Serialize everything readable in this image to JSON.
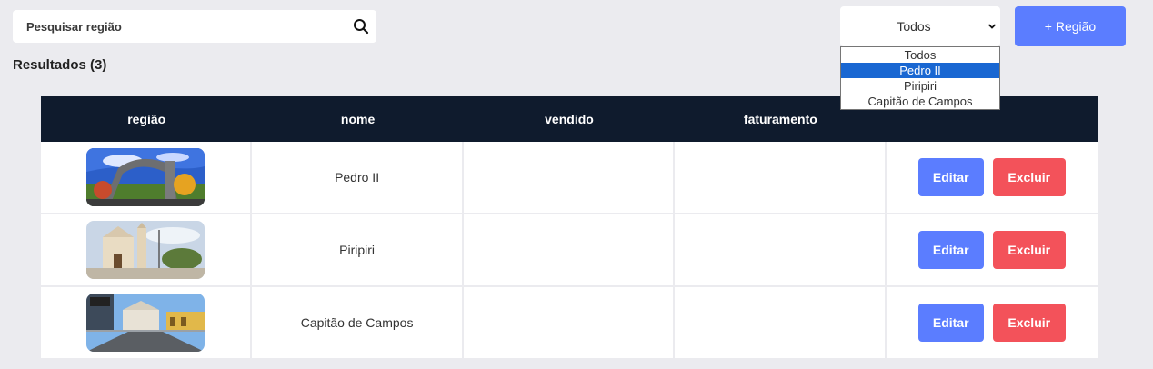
{
  "search": {
    "placeholder": "Pesquisar região"
  },
  "filter": {
    "selected": "Todos",
    "options": [
      "Todos",
      "Pedro II",
      "Piripiri",
      "Capitão de Campos"
    ],
    "highlighted_option": "Pedro II"
  },
  "add_button": {
    "label": "+ Região"
  },
  "results_label": "Resultados (3)",
  "table": {
    "headers": [
      "região",
      "nome",
      "vendido",
      "faturamento",
      ""
    ],
    "rows": [
      {
        "image": "Pedro II photo",
        "nome": "Pedro II",
        "vendido": "",
        "faturamento": "",
        "edit_label": "Editar",
        "delete_label": "Excluir"
      },
      {
        "image": "Piripiri photo",
        "nome": "Piripiri",
        "vendido": "",
        "faturamento": "",
        "edit_label": "Editar",
        "delete_label": "Excluir"
      },
      {
        "image": "Capitão de Campos photo",
        "nome": "Capitão de Campos",
        "vendido": "",
        "faturamento": "",
        "edit_label": "Editar",
        "delete_label": "Excluir"
      }
    ]
  },
  "colors": {
    "background": "#ebebef",
    "header_bg": "#0f1b2d",
    "primary": "#5b7dff",
    "danger": "#f3525a",
    "option_highlight": "#1967d2"
  }
}
